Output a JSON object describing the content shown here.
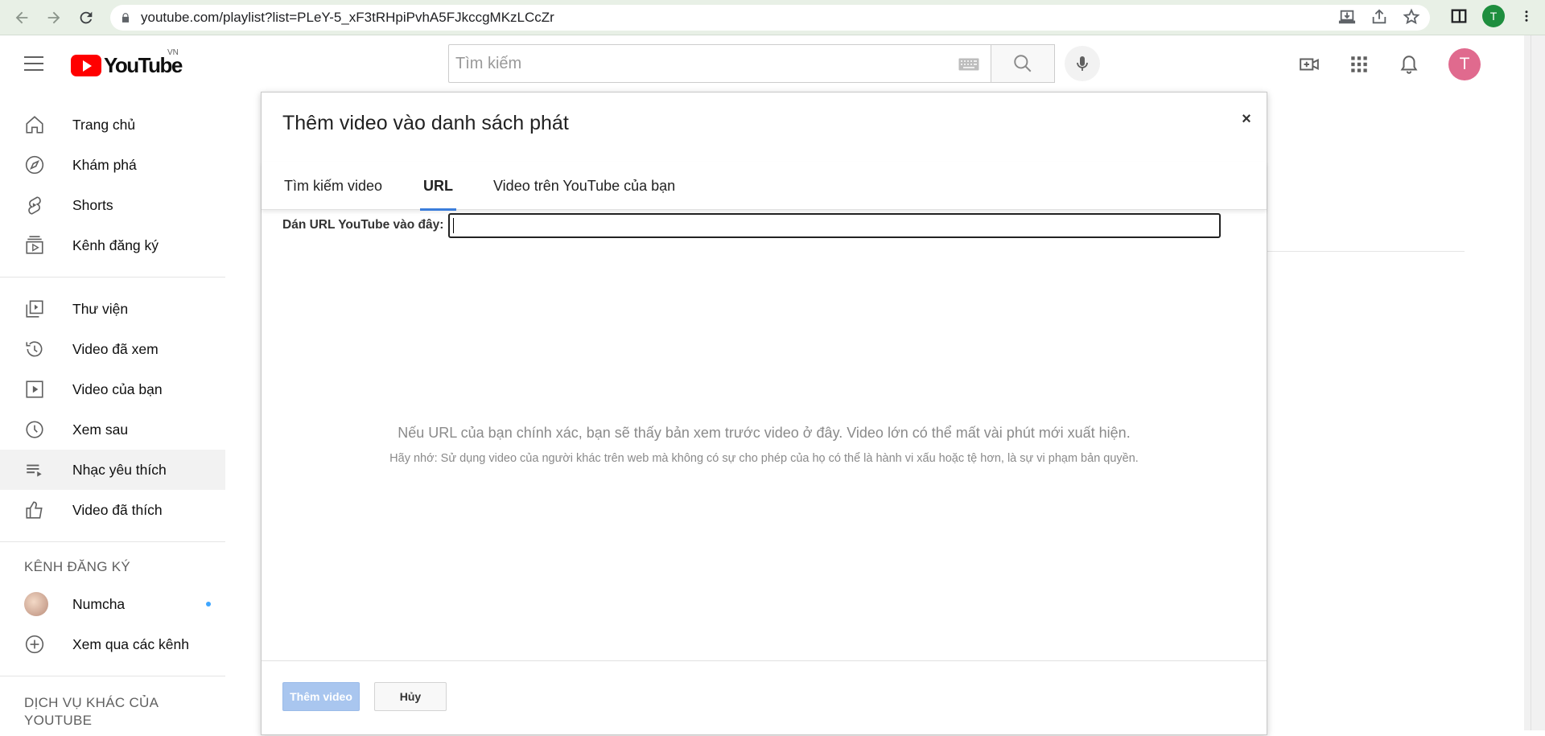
{
  "browser": {
    "url": "youtube.com/playlist?list=PLeY-5_xF3tRHpiPvhA5FJkccgMKzLCcZr",
    "profile_initial": "T"
  },
  "masthead": {
    "logo_text": "YouTube",
    "country_code": "VN",
    "search_placeholder": "Tìm kiếm",
    "avatar_initial": "T"
  },
  "sidebar": {
    "primary": [
      {
        "label": "Trang chủ",
        "icon": "home-icon"
      },
      {
        "label": "Khám phá",
        "icon": "explore-icon"
      },
      {
        "label": "Shorts",
        "icon": "shorts-icon"
      },
      {
        "label": "Kênh đăng ký",
        "icon": "subscriptions-icon"
      }
    ],
    "library": [
      {
        "label": "Thư viện",
        "icon": "library-icon"
      },
      {
        "label": "Video đã xem",
        "icon": "history-icon"
      },
      {
        "label": "Video của bạn",
        "icon": "your-videos-icon"
      },
      {
        "label": "Xem sau",
        "icon": "watch-later-icon"
      },
      {
        "label": "Nhạc yêu thích",
        "icon": "playlist-icon",
        "active": true
      },
      {
        "label": "Video đã thích",
        "icon": "like-icon"
      }
    ],
    "subscriptions_heading": "KÊNH ĐĂNG KÝ",
    "subscriptions": [
      {
        "label": "Numcha"
      },
      {
        "label": "Xem qua các kênh"
      }
    ],
    "more_heading": "DỊCH VỤ KHÁC CỦA YOUTUBE"
  },
  "dialog": {
    "title": "Thêm video vào danh sách phát",
    "close_label": "×",
    "tabs": [
      {
        "label": "Tìm kiếm video"
      },
      {
        "label": "URL",
        "active": true
      },
      {
        "label": "Video trên YouTube của bạn"
      }
    ],
    "url_label": "Dán URL YouTube vào đây:",
    "url_value": "",
    "hint_main": "Nếu URL của bạn chính xác, bạn sẽ thấy bản xem trước video ở đây. Video lớn có thể mất vài phút mới xuất hiện.",
    "hint_sub": "Hãy nhớ: Sử dụng video của người khác trên web mà không có sự cho phép của họ có thể là hành vi xấu hoặc tệ hơn, là sự vi phạm bản quyền.",
    "add_button": "Thêm video",
    "cancel_button": "Hủy"
  },
  "colors": {
    "accent": "#3b7ddb",
    "youtube_red": "#ff0000",
    "avatar": "#e06a8e"
  }
}
